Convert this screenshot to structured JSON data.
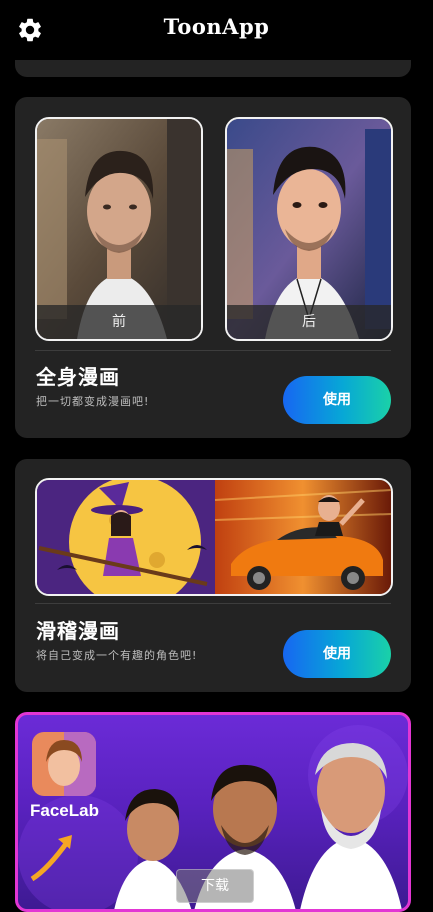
{
  "header": {
    "title": "ToonApp",
    "settings_icon": "gear-icon"
  },
  "cards": [
    {
      "title": "全身漫画",
      "description": "把一切都变成漫画吧!",
      "button_label": "使用",
      "before_label": "前",
      "after_label": "后"
    },
    {
      "title": "滑稽漫画",
      "description": "将自己变成一个有趣的角色吧!",
      "button_label": "使用"
    }
  ],
  "ad": {
    "brand": "FaceLab",
    "download_label": "下载"
  },
  "colors": {
    "background": "#000000",
    "card": "#232323",
    "button_gradient_start": "#1767f2",
    "button_gradient_end": "#1ad1a8",
    "ad_border": "#e236d4",
    "ad_background": "#6b2bd7"
  }
}
